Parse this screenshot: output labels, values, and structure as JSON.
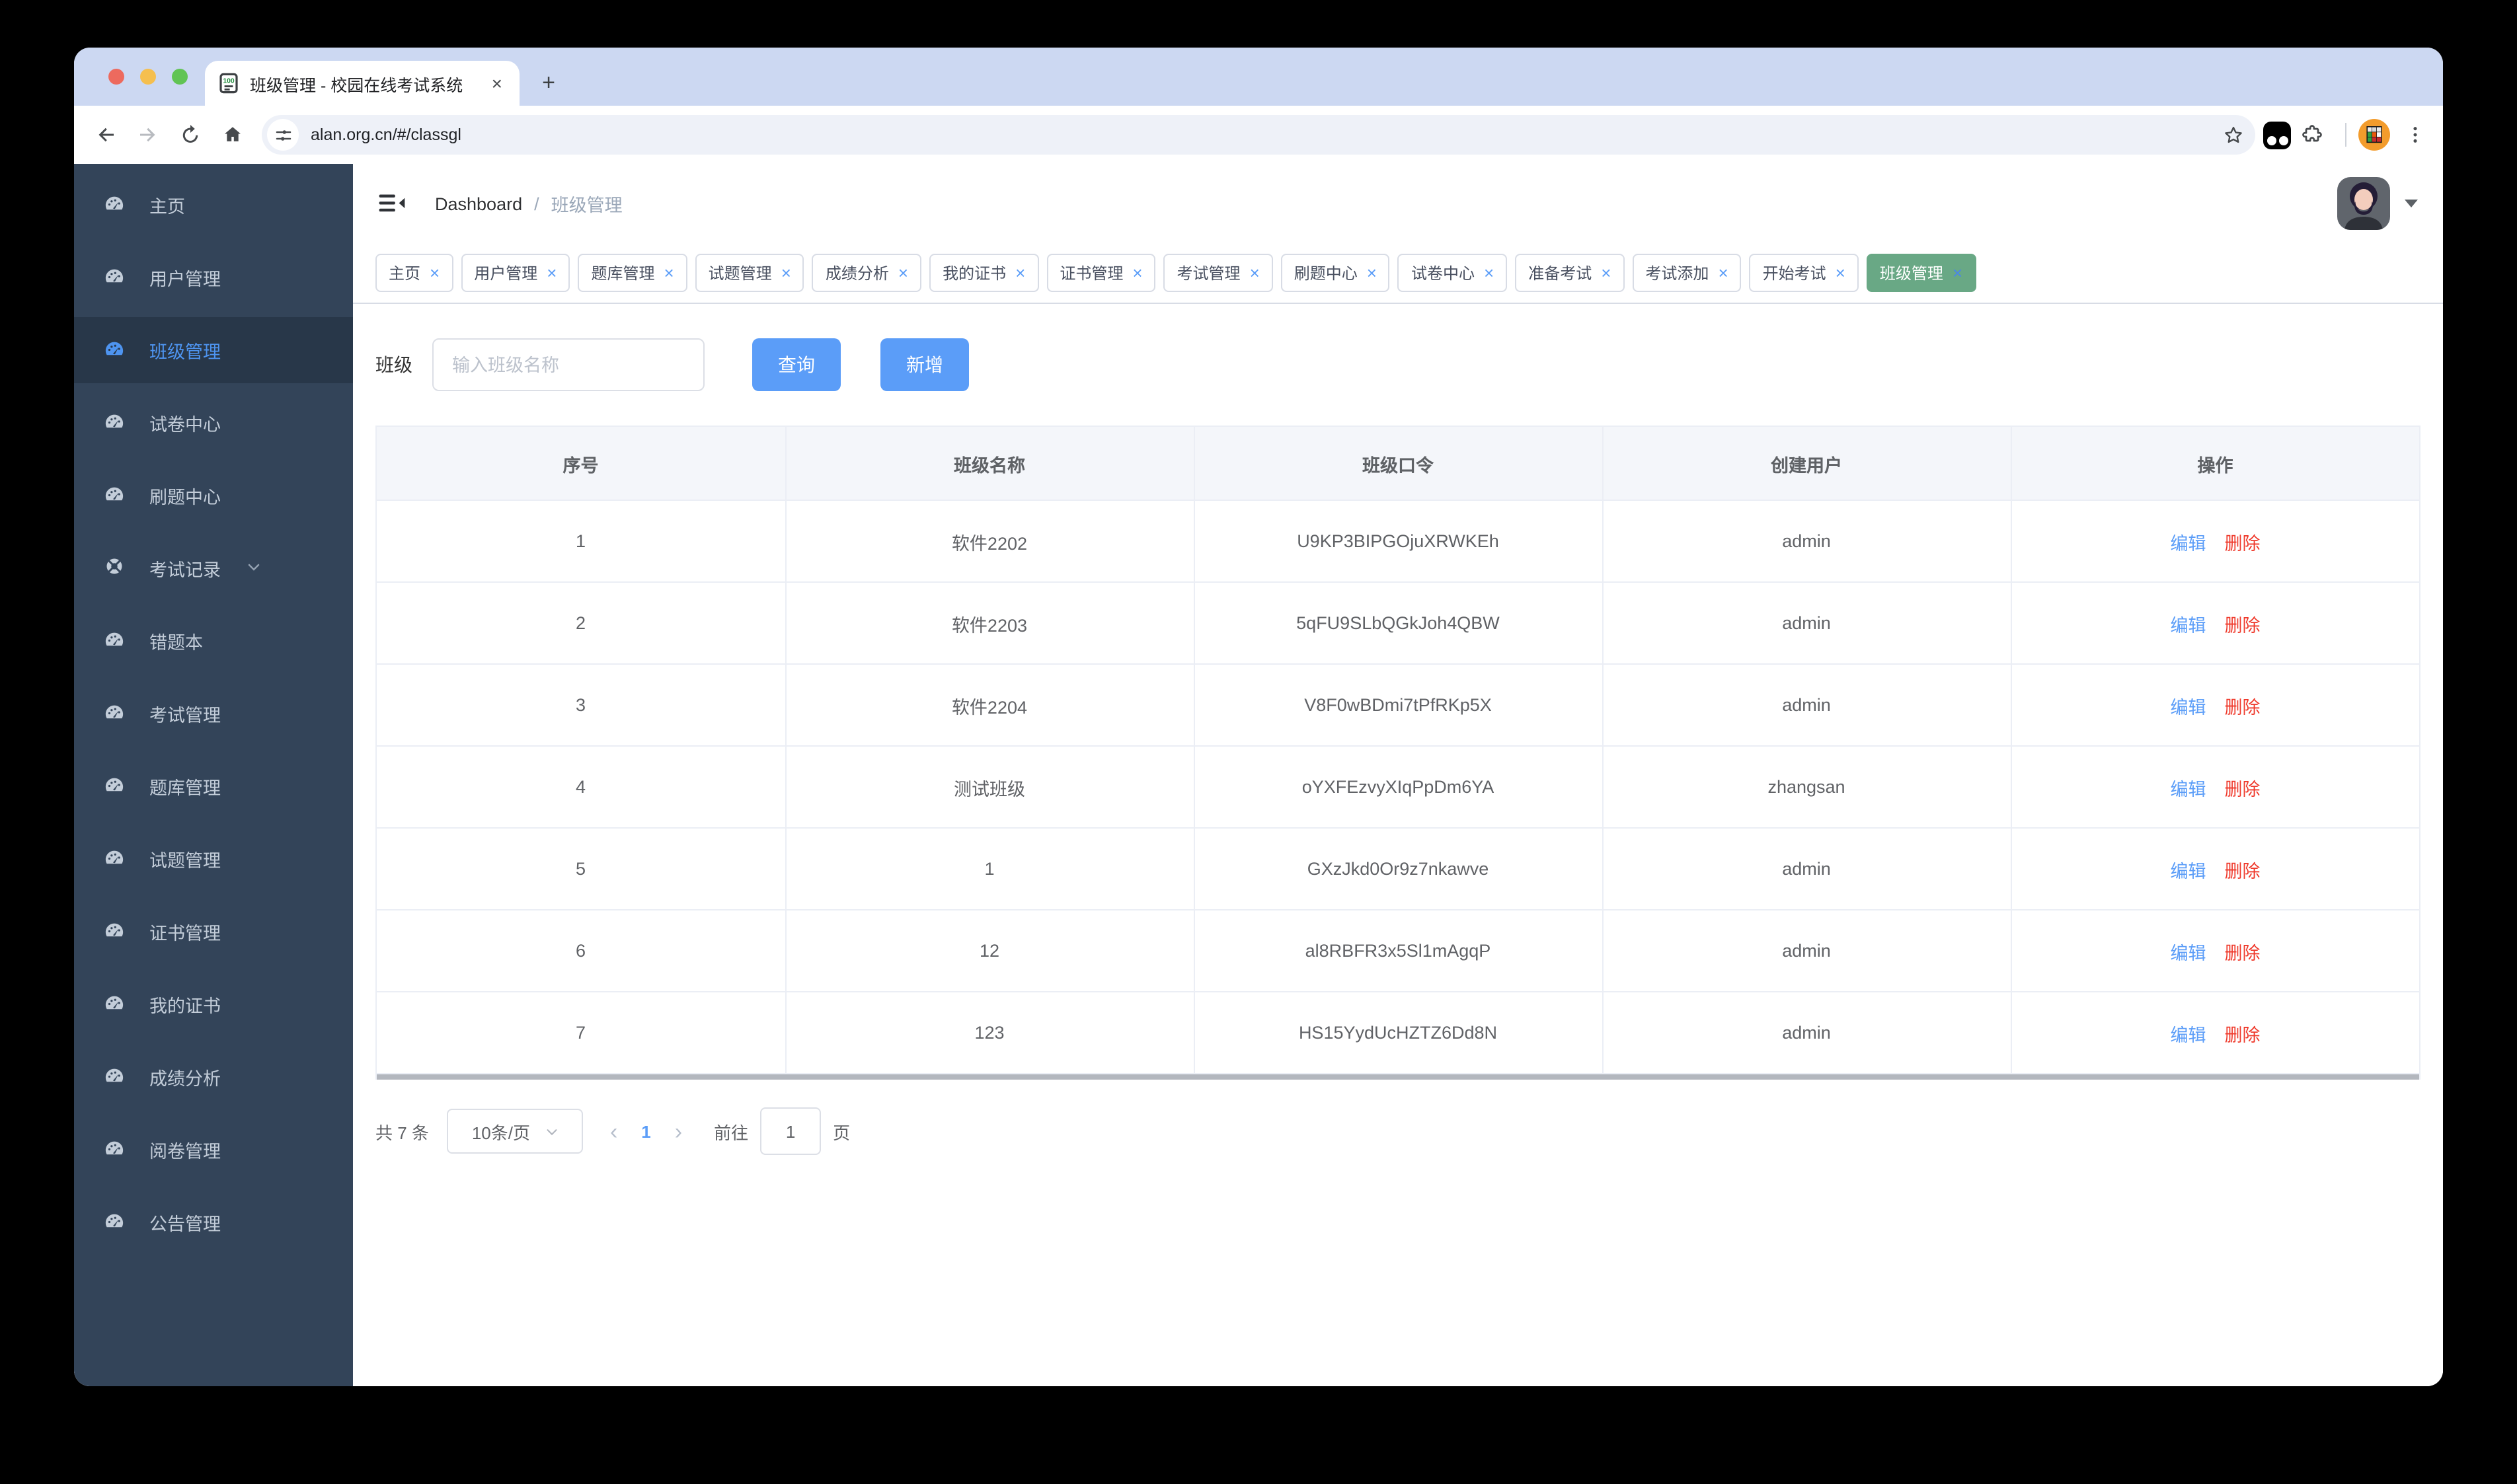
{
  "browser": {
    "tab_title": "班级管理 - 校园在线考试系统",
    "tab_close_glyph": "×",
    "new_tab_glyph": "+",
    "url": "alan.org.cn/#/classgl"
  },
  "navbar": {
    "breadcrumb_root": "Dashboard",
    "breadcrumb_sep": "/",
    "breadcrumb_current": "班级管理"
  },
  "sidebar": {
    "items": [
      {
        "label": "主页"
      },
      {
        "label": "用户管理"
      },
      {
        "label": "班级管理",
        "active": true
      },
      {
        "label": "试卷中心"
      },
      {
        "label": "刷题中心"
      },
      {
        "label": "考试记录",
        "expandable": true
      },
      {
        "label": "错题本"
      },
      {
        "label": "考试管理"
      },
      {
        "label": "题库管理"
      },
      {
        "label": "试题管理"
      },
      {
        "label": "证书管理"
      },
      {
        "label": "我的证书"
      },
      {
        "label": "成绩分析"
      },
      {
        "label": "阅卷管理"
      },
      {
        "label": "公告管理"
      }
    ]
  },
  "tags": {
    "close_glyph": "×",
    "items": [
      {
        "label": "主页"
      },
      {
        "label": "用户管理"
      },
      {
        "label": "题库管理"
      },
      {
        "label": "试题管理"
      },
      {
        "label": "成绩分析"
      },
      {
        "label": "我的证书"
      },
      {
        "label": "证书管理"
      },
      {
        "label": "考试管理"
      },
      {
        "label": "刷题中心"
      },
      {
        "label": "试卷中心"
      },
      {
        "label": "准备考试"
      },
      {
        "label": "考试添加"
      },
      {
        "label": "开始考试"
      },
      {
        "label": "班级管理",
        "active": true
      }
    ]
  },
  "search": {
    "field_label": "班级",
    "placeholder": "输入班级名称",
    "query_label": "查询",
    "add_label": "新增"
  },
  "table": {
    "headers": [
      "序号",
      "班级名称",
      "班级口令",
      "创建用户",
      "操作"
    ],
    "edit_label": "编辑",
    "delete_label": "删除",
    "rows": [
      {
        "seq": "1",
        "name": "软件2202",
        "code": "U9KP3BIPGOjuXRWKEh",
        "creator": "admin"
      },
      {
        "seq": "2",
        "name": "软件2203",
        "code": "5qFU9SLbQGkJoh4QBW",
        "creator": "admin"
      },
      {
        "seq": "3",
        "name": "软件2204",
        "code": "V8F0wBDmi7tPfRKp5X",
        "creator": "admin"
      },
      {
        "seq": "4",
        "name": "测试班级",
        "code": "oYXFEzvyXIqPpDm6YA",
        "creator": "zhangsan"
      },
      {
        "seq": "5",
        "name": "1",
        "code": "GXzJkd0Or9z7nkawve",
        "creator": "admin"
      },
      {
        "seq": "6",
        "name": "12",
        "code": "al8RBFR3x5Sl1mAgqP",
        "creator": "admin"
      },
      {
        "seq": "7",
        "name": "123",
        "code": "HS15YydUcHZTZ6Dd8N",
        "creator": "admin"
      }
    ]
  },
  "pagination": {
    "total": "共 7 条",
    "page_size": "10条/页",
    "prev_glyph": "‹",
    "current_page": "1",
    "next_glyph": "›",
    "goto_label": "前往",
    "goto_value": "1",
    "unit_label": "页"
  },
  "colors": {
    "accent_blue": "#5b9df8",
    "danger_red": "#ef392b",
    "active_tag_green": "#69a885",
    "sidebar_bg": "#334459",
    "sidebar_active_bg": "#283749",
    "chrome_strip": "#ccd8f2"
  }
}
